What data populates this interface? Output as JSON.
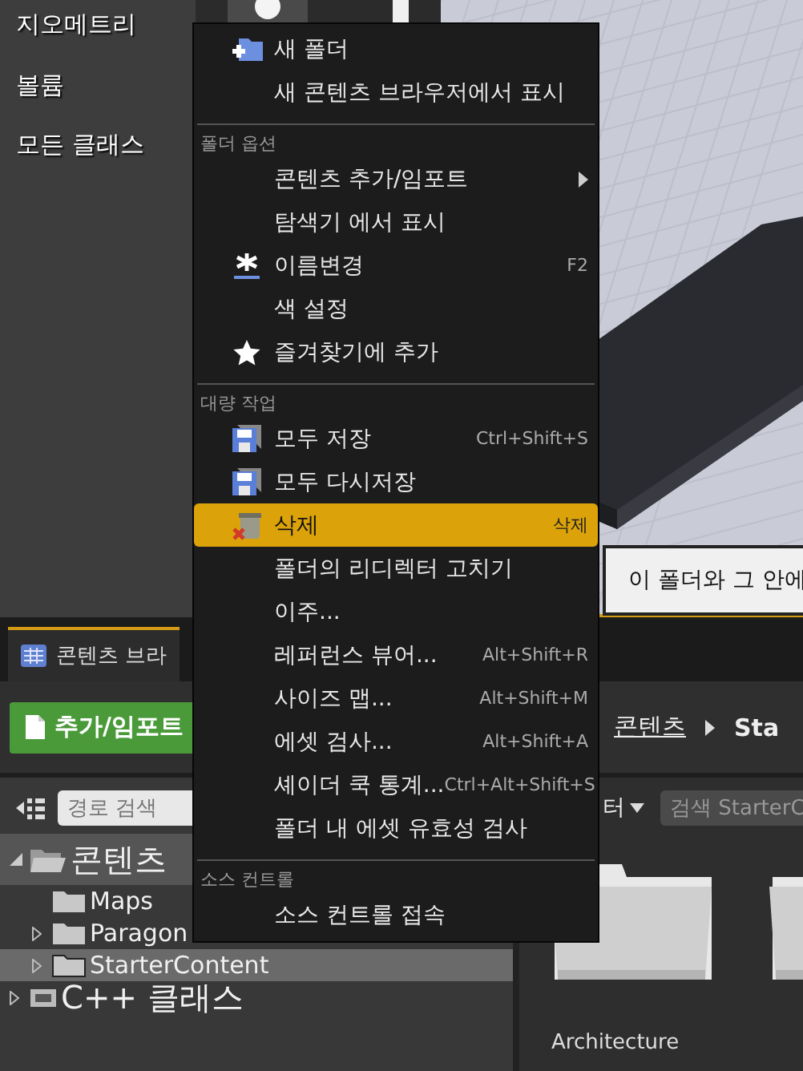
{
  "left_panel": {
    "items": [
      "지오메트리",
      "볼륨",
      "모든 클래스"
    ]
  },
  "tab": {
    "label": "콘텐츠 브라"
  },
  "toolbar": {
    "add_button": "추가/임포트",
    "breadcrumb": [
      "콘텐츠",
      "Sta"
    ]
  },
  "path_search": {
    "placeholder": "경로 검색"
  },
  "tree": [
    {
      "label": "콘텐츠",
      "kind": "folder",
      "expanded": true,
      "active": true,
      "selected": false,
      "children": [
        {
          "label": "Maps",
          "kind": "folder",
          "active": false,
          "selected": false
        },
        {
          "label": "Paragon",
          "kind": "folder",
          "expanded": false,
          "active": false,
          "selected": false
        },
        {
          "label": "StarterContent",
          "kind": "folder",
          "expanded": false,
          "active": false,
          "selected": true
        }
      ]
    },
    {
      "label": "C++ 클래스",
      "kind": "cpp",
      "expanded": false,
      "active": false,
      "selected": false
    }
  ],
  "content": {
    "filter_label": "터",
    "search": {
      "placeholder": "검색 StarterC"
    },
    "assets": [
      {
        "kind": "folder",
        "label": "Architecture"
      },
      {
        "kind": "folder"
      }
    ]
  },
  "tooltip": {
    "text": "이 폴더와 그 안에"
  },
  "context_menu": {
    "sections": [
      {
        "items": [
          {
            "label": "새 폴더",
            "kind": "new-folder",
            "selected": false
          },
          {
            "label": "새 콘텐츠 브라우저에서 표시",
            "kind": "plain",
            "selected": false
          }
        ]
      },
      {
        "header": "폴더 옵션",
        "items": [
          {
            "label": "콘텐츠 추가/임포트",
            "kind": "plain",
            "submenu": true,
            "selected": false
          },
          {
            "label": "탐색기 에서 표시",
            "kind": "plain",
            "selected": false
          },
          {
            "label": "이름변경",
            "kind": "rename",
            "shortcut": "F2",
            "selected": false
          },
          {
            "label": "색 설정",
            "kind": "plain",
            "selected": false
          },
          {
            "label": "즐겨찾기에 추가",
            "kind": "favorite",
            "selected": false
          }
        ]
      },
      {
        "header": "대량 작업",
        "items": [
          {
            "label": "모두 저장",
            "kind": "save",
            "shortcut": "Ctrl+Shift+S",
            "selected": false
          },
          {
            "label": "모두 다시저장",
            "kind": "save",
            "selected": false
          },
          {
            "label": "삭제",
            "kind": "delete",
            "shortcut": "삭제",
            "selected": true
          },
          {
            "label": "폴더의 리디렉터 고치기",
            "kind": "plain",
            "selected": false
          },
          {
            "label": "이주...",
            "kind": "plain",
            "selected": false
          },
          {
            "label": "레퍼런스 뷰어...",
            "kind": "plain",
            "shortcut": "Alt+Shift+R",
            "selected": false
          },
          {
            "label": "사이즈 맵...",
            "kind": "plain",
            "shortcut": "Alt+Shift+M",
            "selected": false
          },
          {
            "label": "에셋 검사...",
            "kind": "plain",
            "shortcut": "Alt+Shift+A",
            "selected": false
          },
          {
            "label": "셰이더 쿡 통계...",
            "kind": "plain",
            "shortcut": "Ctrl+Alt+Shift+S",
            "selected": false
          },
          {
            "label": "폴더 내 에셋 유효성 검사",
            "kind": "plain",
            "selected": false
          }
        ]
      },
      {
        "header": "소스 컨트롤",
        "items": [
          {
            "label": "소스 컨트롤 접속",
            "kind": "plain",
            "selected": false
          }
        ]
      }
    ]
  }
}
